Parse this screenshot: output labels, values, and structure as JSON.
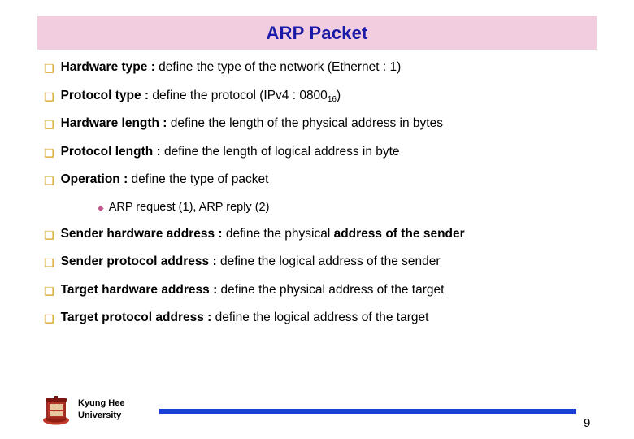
{
  "slide": {
    "title": "ARP Packet",
    "title_bg": "#f2ccdf",
    "title_color": "#1a1aa8",
    "bullet_marker": "❑",
    "sub_marker": "◆",
    "bullets": [
      {
        "label": "Hardware type :",
        "rest": " define the type of the network (Ethernet : 1)"
      },
      {
        "label": "Protocol type :",
        "rest_pre": " define the protocol (IPv4 : 0800",
        "subscript": "16",
        "rest_post": ")"
      },
      {
        "label": "Hardware length :",
        "rest": " define the length of the physical address in bytes"
      },
      {
        "label": "Protocol length :",
        "rest": " define the length of logical address in byte"
      },
      {
        "label": "Operation :",
        "rest": " define the type of packet"
      },
      {
        "label": "Sender hardware address :",
        "rest": " define the physical ",
        "rest_bold": "address of the sender"
      },
      {
        "label": "Sender protocol address :",
        "rest": " define the logical address of the sender"
      },
      {
        "label": "Target hardware address :",
        "rest": " define the physical address of the target"
      },
      {
        "label": "Target protocol address :",
        "rest": " define the logical address of the target"
      }
    ],
    "sub_bullet": "ARP request (1), ARP reply (2)",
    "footer": {
      "org_line1": "Kyung Hee",
      "org_line2": "University",
      "rule_color": "#1a3fd4",
      "page_number": "9"
    }
  }
}
